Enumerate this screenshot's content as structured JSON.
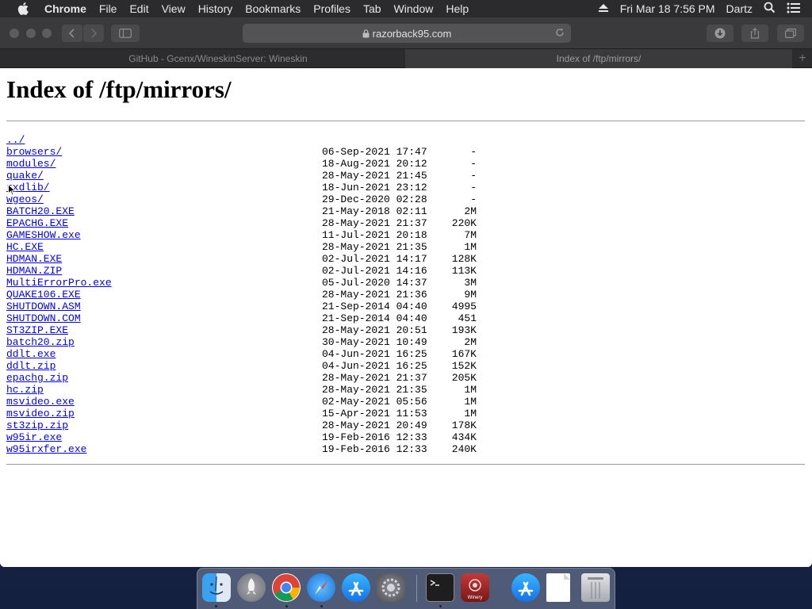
{
  "menubar": {
    "app_name": "Chrome",
    "items": [
      "File",
      "Edit",
      "View",
      "History",
      "Bookmarks",
      "Profiles",
      "Tab",
      "Window",
      "Help"
    ],
    "clock": "Fri Mar 18  7:56 PM",
    "user": "Dartz"
  },
  "browser": {
    "url": "razorback95.com",
    "tabs": [
      {
        "label": "GitHub - Gcenx/WineskinServer: Wineskin",
        "active": false
      },
      {
        "label": "Index of /ftp/mirrors/",
        "active": true
      }
    ]
  },
  "page": {
    "title": "Index of /ftp/mirrors/",
    "parent_link": "../",
    "entries": [
      {
        "name": "browsers/",
        "date": "06-Sep-2021 17:47",
        "size": "-"
      },
      {
        "name": "modules/",
        "date": "18-Aug-2021 20:12",
        "size": "-"
      },
      {
        "name": "quake/",
        "date": "28-May-2021 21:45",
        "size": "-"
      },
      {
        "name": "rxdlib/",
        "date": "18-Jun-2021 23:12",
        "size": "-"
      },
      {
        "name": "wgeos/",
        "date": "29-Dec-2020 02:28",
        "size": "-"
      },
      {
        "name": "BATCH20.EXE",
        "date": "21-May-2018 02:11",
        "size": "2M"
      },
      {
        "name": "EPACHG.EXE",
        "date": "28-May-2021 21:37",
        "size": "220K"
      },
      {
        "name": "GAMESHOW.exe",
        "date": "11-Jul-2021 20:18",
        "size": "7M"
      },
      {
        "name": "HC.EXE",
        "date": "28-May-2021 21:35",
        "size": "1M"
      },
      {
        "name": "HDMAN.EXE",
        "date": "02-Jul-2021 14:17",
        "size": "128K"
      },
      {
        "name": "HDMAN.ZIP",
        "date": "02-Jul-2021 14:16",
        "size": "113K"
      },
      {
        "name": "MultiErrorPro.exe",
        "date": "05-Jul-2020 14:37",
        "size": "3M"
      },
      {
        "name": "QUAKE106.EXE",
        "date": "28-May-2021 21:36",
        "size": "9M"
      },
      {
        "name": "SHUTDOWN.ASM",
        "date": "21-Sep-2014 04:40",
        "size": "4995"
      },
      {
        "name": "SHUTDOWN.COM",
        "date": "21-Sep-2014 04:40",
        "size": "451"
      },
      {
        "name": "ST3ZIP.EXE",
        "date": "28-May-2021 20:51",
        "size": "193K"
      },
      {
        "name": "batch20.zip",
        "date": "30-May-2021 10:49",
        "size": "2M"
      },
      {
        "name": "ddlt.exe",
        "date": "04-Jun-2021 16:25",
        "size": "167K"
      },
      {
        "name": "ddlt.zip",
        "date": "04-Jun-2021 16:25",
        "size": "152K"
      },
      {
        "name": "epachg.zip",
        "date": "28-May-2021 21:37",
        "size": "205K"
      },
      {
        "name": "hc.zip",
        "date": "28-May-2021 21:35",
        "size": "1M"
      },
      {
        "name": "msvideo.exe",
        "date": "02-May-2021 05:56",
        "size": "1M"
      },
      {
        "name": "msvideo.zip",
        "date": "15-Apr-2021 11:53",
        "size": "1M"
      },
      {
        "name": "st3zip.zip",
        "date": "28-May-2021 20:49",
        "size": "178K"
      },
      {
        "name": "w95ir.exe",
        "date": "19-Feb-2016 12:33",
        "size": "434K"
      },
      {
        "name": "w95irxfer.exe",
        "date": "19-Feb-2016 12:33",
        "size": "240K"
      }
    ]
  },
  "dock": {
    "apps": [
      "finder",
      "launchpad",
      "chrome",
      "safari",
      "app-store",
      "system-preferences",
      "terminal",
      "winery",
      "app-store-2",
      "document",
      "trash"
    ],
    "winery_label": "Winery"
  },
  "colors": {
    "link": "#0000ee",
    "menubar_bg": "#2b2b2d",
    "toolbar_bg": "#3a3a3c"
  }
}
